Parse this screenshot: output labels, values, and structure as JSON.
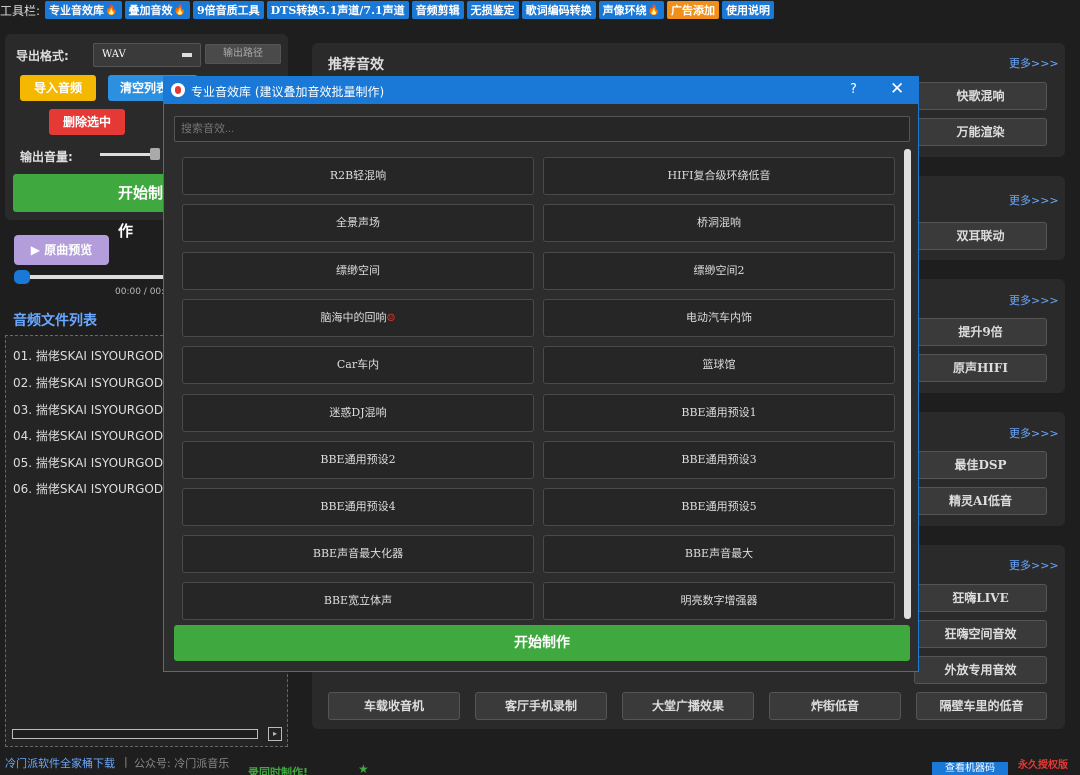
{
  "toolbar": {
    "label": "工具栏:",
    "items": [
      {
        "label": "专业音效库",
        "fire": true,
        "color": "#1a78d6"
      },
      {
        "label": "叠加音效",
        "fire": true,
        "color": "#1a78d6"
      },
      {
        "label": "9倍音质工具",
        "fire": false,
        "color": "#1a78d6"
      },
      {
        "label": "DTS转换5.1声道/7.1声道",
        "fire": false,
        "color": "#1a78d6"
      },
      {
        "label": "音频剪辑",
        "fire": false,
        "color": "#1a78d6"
      },
      {
        "label": "无损鉴定",
        "fire": false,
        "color": "#1a78d6"
      },
      {
        "label": "歌词编码转换",
        "fire": false,
        "color": "#1a78d6"
      },
      {
        "label": "声像环绕",
        "fire": true,
        "color": "#1a78d6"
      },
      {
        "label": "广告添加",
        "fire": false,
        "color": "#f0901a"
      },
      {
        "label": "使用说明",
        "fire": false,
        "color": "#1a78d6"
      }
    ]
  },
  "left": {
    "format_label": "导出格式:",
    "format_value": "WAV",
    "output_path_button": "输出路径",
    "import_button": "导入音频",
    "clear_button": "清空列表",
    "delete_button": "删除选中",
    "volume_label": "输出音量:",
    "start_button": "开始制作",
    "preview_button": "▶ 原曲预览",
    "time": "00:00 / 00:00",
    "list_title": "音频文件列表",
    "files": [
      "01. 揣佬SKAI ISYOURGOD",
      "02. 揣佬SKAI ISYOURGOD",
      "03. 揣佬SKAI ISYOURGOD",
      "04. 揣佬SKAI ISYOURGOD",
      "05. 揣佬SKAI ISYOURGOD",
      "06. 揣佬SKAI ISYOURGOD"
    ]
  },
  "footer": {
    "download_link": "冷门派软件全家桶下载",
    "separator": "|",
    "public_account": "公众号: 冷门派音乐",
    "recording": "录同时制作!",
    "star": "★",
    "machine_code_button": "查看机器码",
    "authorization": "永久授权版"
  },
  "right": {
    "recommended_title": "推荐音效",
    "more": "更多>>>",
    "panel1_buttons": [
      "快歌混响",
      "万能渲染"
    ],
    "panel2_buttons": [
      "双耳联动"
    ],
    "panel3_buttons": [
      "提升9倍",
      "原声HIFI"
    ],
    "panel4_buttons": [
      "最佳DSP",
      "精灵AI低音"
    ],
    "panel5_side_buttons": [
      "狂嗨LIVE",
      "狂嗨空间音效",
      "外放专用音效"
    ],
    "panel5_bottom_buttons": [
      "车载收音机",
      "客厅手机录制",
      "大堂广播效果",
      "炸街低音",
      "隔壁车里的低音"
    ]
  },
  "dialog": {
    "title": "专业音效库 (建议叠加音效批量制作)",
    "help": "?",
    "close": "✕",
    "search_placeholder": "搜索音效...",
    "effects": [
      {
        "label": "R2B轻混响",
        "tag": ""
      },
      {
        "label": "HIFI复合级环绕低音",
        "tag": ""
      },
      {
        "label": "全景声场",
        "tag": ""
      },
      {
        "label": "桥洞混响",
        "tag": ""
      },
      {
        "label": "缥缈空间",
        "tag": ""
      },
      {
        "label": "缥缈空间2",
        "tag": ""
      },
      {
        "label": "脑海中的回响",
        "tag": "☺"
      },
      {
        "label": "电动汽车内饰",
        "tag": ""
      },
      {
        "label": "Car车内",
        "tag": ""
      },
      {
        "label": "篮球馆",
        "tag": ""
      },
      {
        "label": "迷惑DJ混响",
        "tag": ""
      },
      {
        "label": "BBE通用预设1",
        "tag": ""
      },
      {
        "label": "BBE通用预设2",
        "tag": ""
      },
      {
        "label": "BBE通用预设3",
        "tag": ""
      },
      {
        "label": "BBE通用预设4",
        "tag": ""
      },
      {
        "label": "BBE通用预设5",
        "tag": ""
      },
      {
        "label": "BBE声音最大化器",
        "tag": ""
      },
      {
        "label": "BBE声音最大",
        "tag": ""
      },
      {
        "label": "BBE宽立体声",
        "tag": ""
      },
      {
        "label": "明亮数字增强器",
        "tag": ""
      }
    ],
    "start_button": "开始制作"
  }
}
